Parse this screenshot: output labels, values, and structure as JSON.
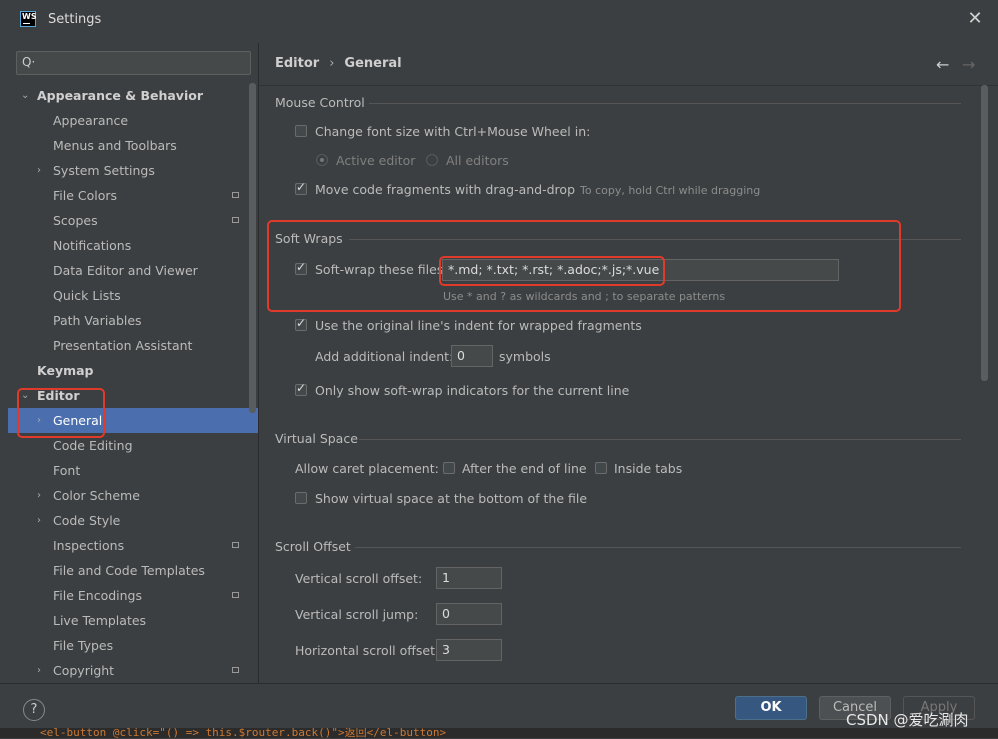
{
  "window": {
    "title": "Settings",
    "close_glyph": "✕"
  },
  "sidebar": {
    "search_icon": "Q·",
    "items": [
      {
        "label": "Appearance & Behavior",
        "arrow": "⌄",
        "bold": true
      },
      {
        "label": "Appearance"
      },
      {
        "label": "Menus and Toolbars"
      },
      {
        "label": "System Settings",
        "arrow": "›"
      },
      {
        "label": "File Colors",
        "project": true
      },
      {
        "label": "Scopes",
        "project": true
      },
      {
        "label": "Notifications"
      },
      {
        "label": "Data Editor and Viewer"
      },
      {
        "label": "Quick Lists"
      },
      {
        "label": "Path Variables"
      },
      {
        "label": "Presentation Assistant"
      },
      {
        "label": "Keymap",
        "bold": true
      },
      {
        "label": "Editor",
        "arrow": "⌄",
        "bold": true
      },
      {
        "label": "General",
        "arrow": "›",
        "selected": true
      },
      {
        "label": "Code Editing"
      },
      {
        "label": "Font"
      },
      {
        "label": "Color Scheme",
        "arrow": "›"
      },
      {
        "label": "Code Style",
        "arrow": "›"
      },
      {
        "label": "Inspections",
        "project": true
      },
      {
        "label": "File and Code Templates"
      },
      {
        "label": "File Encodings",
        "project": true
      },
      {
        "label": "Live Templates"
      },
      {
        "label": "File Types"
      },
      {
        "label": "Copyright",
        "arrow": "›",
        "project": true
      }
    ]
  },
  "breadcrumb": {
    "part1": "Editor",
    "separator": "›",
    "part2": "General",
    "back": "←",
    "forward": "→"
  },
  "mouse_control": {
    "title": "Mouse Control",
    "font_size_label": "Change font size with Ctrl+Mouse Wheel in:",
    "font_size_checked": false,
    "radio_active": "Active editor",
    "radio_all": "All editors",
    "drag_label": "Move code fragments with drag-and-drop",
    "drag_checked": true,
    "drag_hint": "To copy, hold Ctrl while dragging"
  },
  "soft_wraps": {
    "title": "Soft Wraps",
    "wrap_label": "Soft-wrap these files:",
    "wrap_checked": true,
    "wrap_value": "*.md; *.txt; *.rst; *.adoc;*.js;*.vue",
    "wrap_hint": "Use * and ? as wildcards and ; to separate patterns",
    "indent_label": "Use the original line's indent for wrapped fragments",
    "indent_checked": true,
    "add_indent_label": "Add additional indent:",
    "add_indent_value": "0",
    "symbols_label": "symbols",
    "indicators_label": "Only show soft-wrap indicators for the current line",
    "indicators_checked": true
  },
  "virtual_space": {
    "title": "Virtual Space",
    "caret_label": "Allow caret placement:",
    "after_end_label": "After the end of line",
    "inside_tabs_label": "Inside tabs",
    "show_virtual_label": "Show virtual space at the bottom of the file"
  },
  "scroll_offset": {
    "title": "Scroll Offset",
    "v_offset_label": "Vertical scroll offset:",
    "v_offset_value": "1",
    "v_jump_label": "Vertical scroll jump:",
    "v_jump_value": "0",
    "h_offset_label": "Horizontal scroll offset:",
    "h_offset_value": "3"
  },
  "buttons": {
    "help": "?",
    "ok": "OK",
    "cancel": "Cancel",
    "apply": "Apply"
  },
  "background_code": "<el-button @click=\"() => this.$router.back()\">返回</el-button>",
  "watermark": "CSDN @爱吃涮肉",
  "colors": {
    "accent": "#4b6eaf",
    "highlight": "#e03a2a",
    "ok_button": "#365880"
  }
}
